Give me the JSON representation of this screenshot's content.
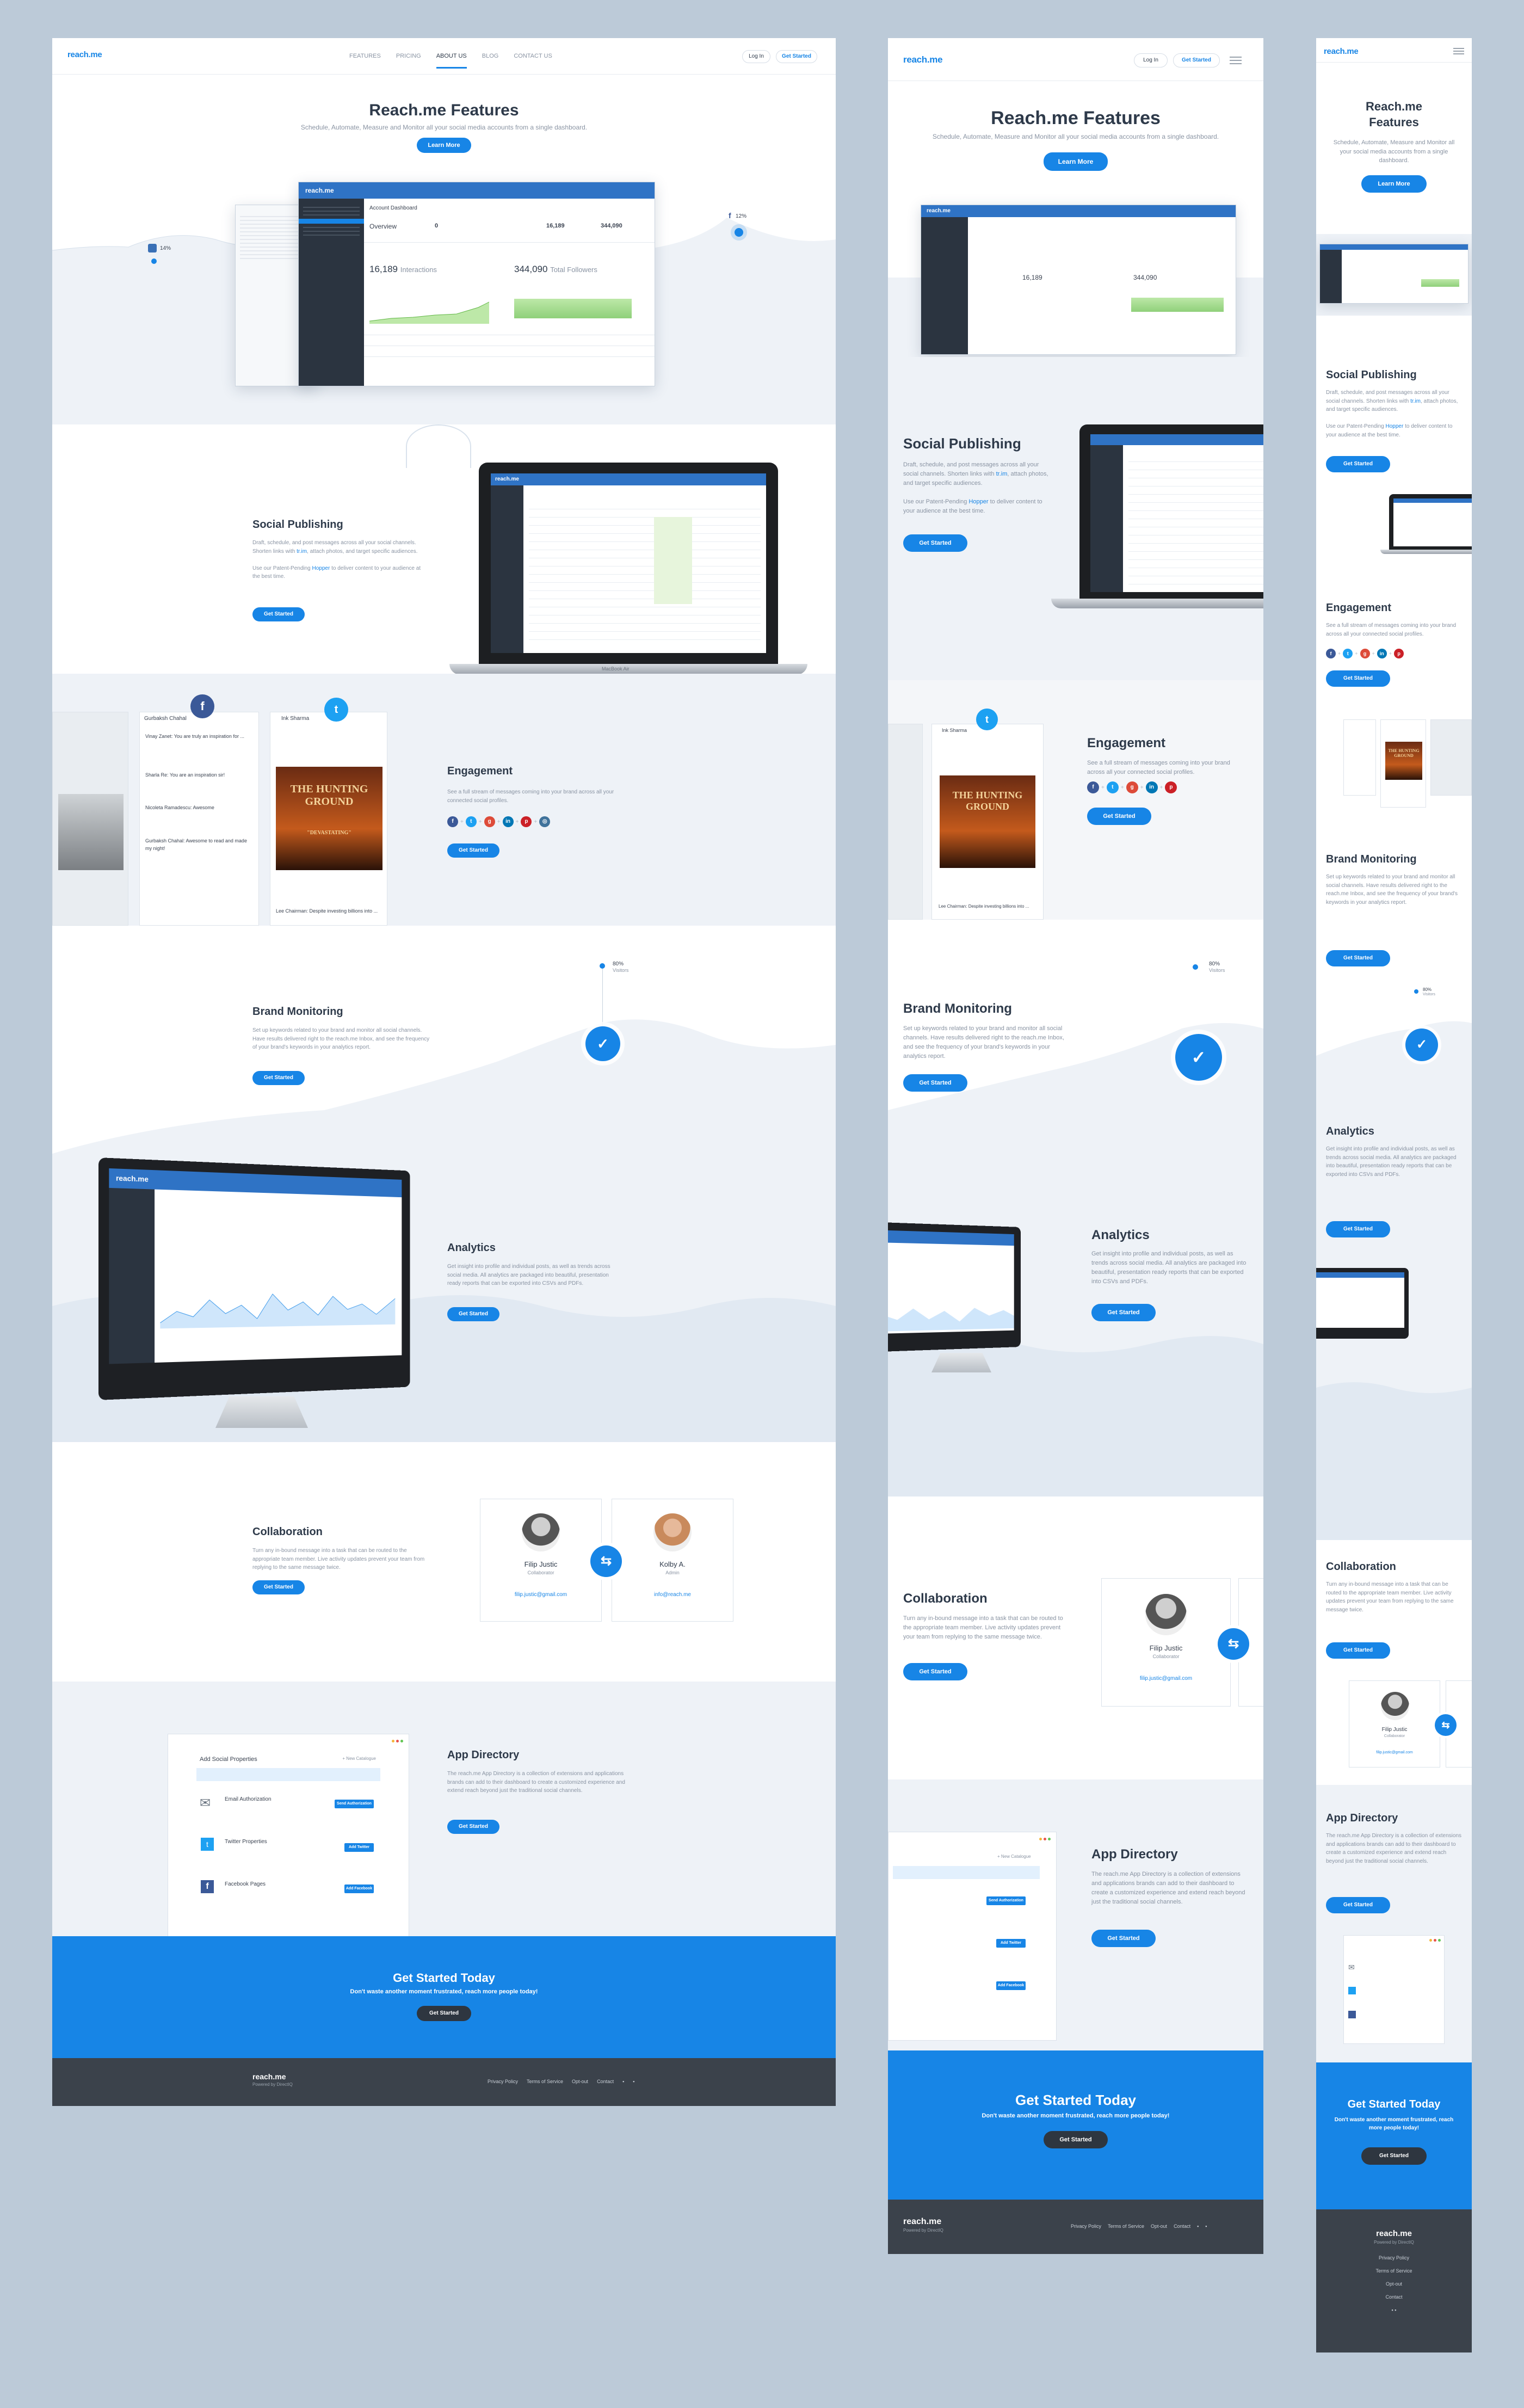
{
  "brand": {
    "name": "reach.me",
    "tagline": "Powered by DirectIQ",
    "accent": "#1785e6",
    "dark": "#3b424b"
  },
  "nav": {
    "items": [
      "FEATURES",
      "PRICING",
      "ABOUT US",
      "BLOG",
      "CONTACT US"
    ],
    "active": "ABOUT US",
    "login": "Log In",
    "get_started": "Get Started"
  },
  "hero": {
    "title": "Reach.me Features",
    "subtitle": "Schedule, Automate, Measure and Monitor all your social media accounts from a single dashboard.",
    "cta": "Learn More",
    "badge_left": "14%",
    "badge_right": "12%"
  },
  "dashboard": {
    "logo": "reach.me",
    "title": "Account Dashboard",
    "overview": "Overview",
    "interactions_value": "16,189",
    "interactions_label": "Interactions",
    "followers_value": "344,090",
    "followers_label": "Total Followers",
    "stat1": "16,189",
    "stat2": "344,090",
    "stat3": "0"
  },
  "publishing": {
    "title": "Social Publishing",
    "text_a": "Draft, schedule, and post messages across all your social channels. Shorten links with",
    "link_short": "tr.im",
    "text_b": ", attach photos, and target specific audiences.",
    "text_c": "Use our Patent-Pending",
    "link_hopper": "Hopper",
    "text_d": "to deliver content to your audience at the best time.",
    "cta": "Get Started",
    "laptop_label": "MacBook Air"
  },
  "engagement": {
    "title": "Engagement",
    "text": "See a full stream of messages coming into your brand across all your connected social profiles.",
    "cta": "Get Started",
    "fb_user": "Gurbaksh Chahal",
    "tw_user": "Ink Sharma",
    "posts": [
      "Vinay Zanet: You are truly an inspiration for ...",
      "Sharla Re: You are an inspiration sir!",
      "Nicoleta Ramadescu: Awesome",
      "Gurbaksh Chahal: Awesome to read and made my night!",
      "Lee Chairman: Despite investing billions into ..."
    ],
    "poster_title": "THE HUNTING GROUND",
    "poster_sub": "\"DEVASTATING\""
  },
  "monitoring": {
    "title": "Brand Monitoring",
    "text": "Set up keywords related to your brand and monitor all social channels. Have results delivered right to the reach.me Inbox, and see the frequency of your brand's keywords in your analytics report.",
    "cta": "Get Started",
    "stat_value": "80%",
    "stat_label": "Visitors"
  },
  "analytics": {
    "title": "Analytics",
    "text": "Get insight into profile and individual posts, as well as trends across social media. All analytics are packaged into beautiful, presentation ready reports that can be exported into CSVs and PDFs.",
    "cta": "Get Started"
  },
  "collaboration": {
    "title": "Collaboration",
    "text": "Turn any in-bound message into a task that can be routed to the appropriate team member. Live activity updates prevent your team from replying to the same message twice.",
    "cta": "Get Started",
    "members": [
      {
        "name": "Filip Justic",
        "role": "Collaborator",
        "email": "filip.justic@gmail.com"
      },
      {
        "name": "Kolby A.",
        "role": "Admin",
        "email": "info@reach.me"
      }
    ]
  },
  "appdir": {
    "title": "App Directory",
    "text": "The reach.me App Directory is a collection of extensions and applications brands can add to their dashboard to create a customized experience and extend reach beyond just the traditional social channels.",
    "cta": "Get Started",
    "panel_title": "Add Social Properties",
    "panel_link": "+ New Catalogue",
    "items": [
      {
        "name": "Email Authorization",
        "btn": "Send Authorization"
      },
      {
        "name": "Twitter Properties",
        "btn": "Add Twitter"
      },
      {
        "name": "Facebook Pages",
        "btn": "Add Facebook"
      }
    ]
  },
  "cta_band": {
    "title": "Get Started Today",
    "subtitle": "Don't waste another moment frustrated, reach more people today!",
    "button": "Get Started"
  },
  "footer": {
    "links": [
      "Privacy Policy",
      "Terms of Service",
      "Opt-out",
      "Contact"
    ]
  }
}
